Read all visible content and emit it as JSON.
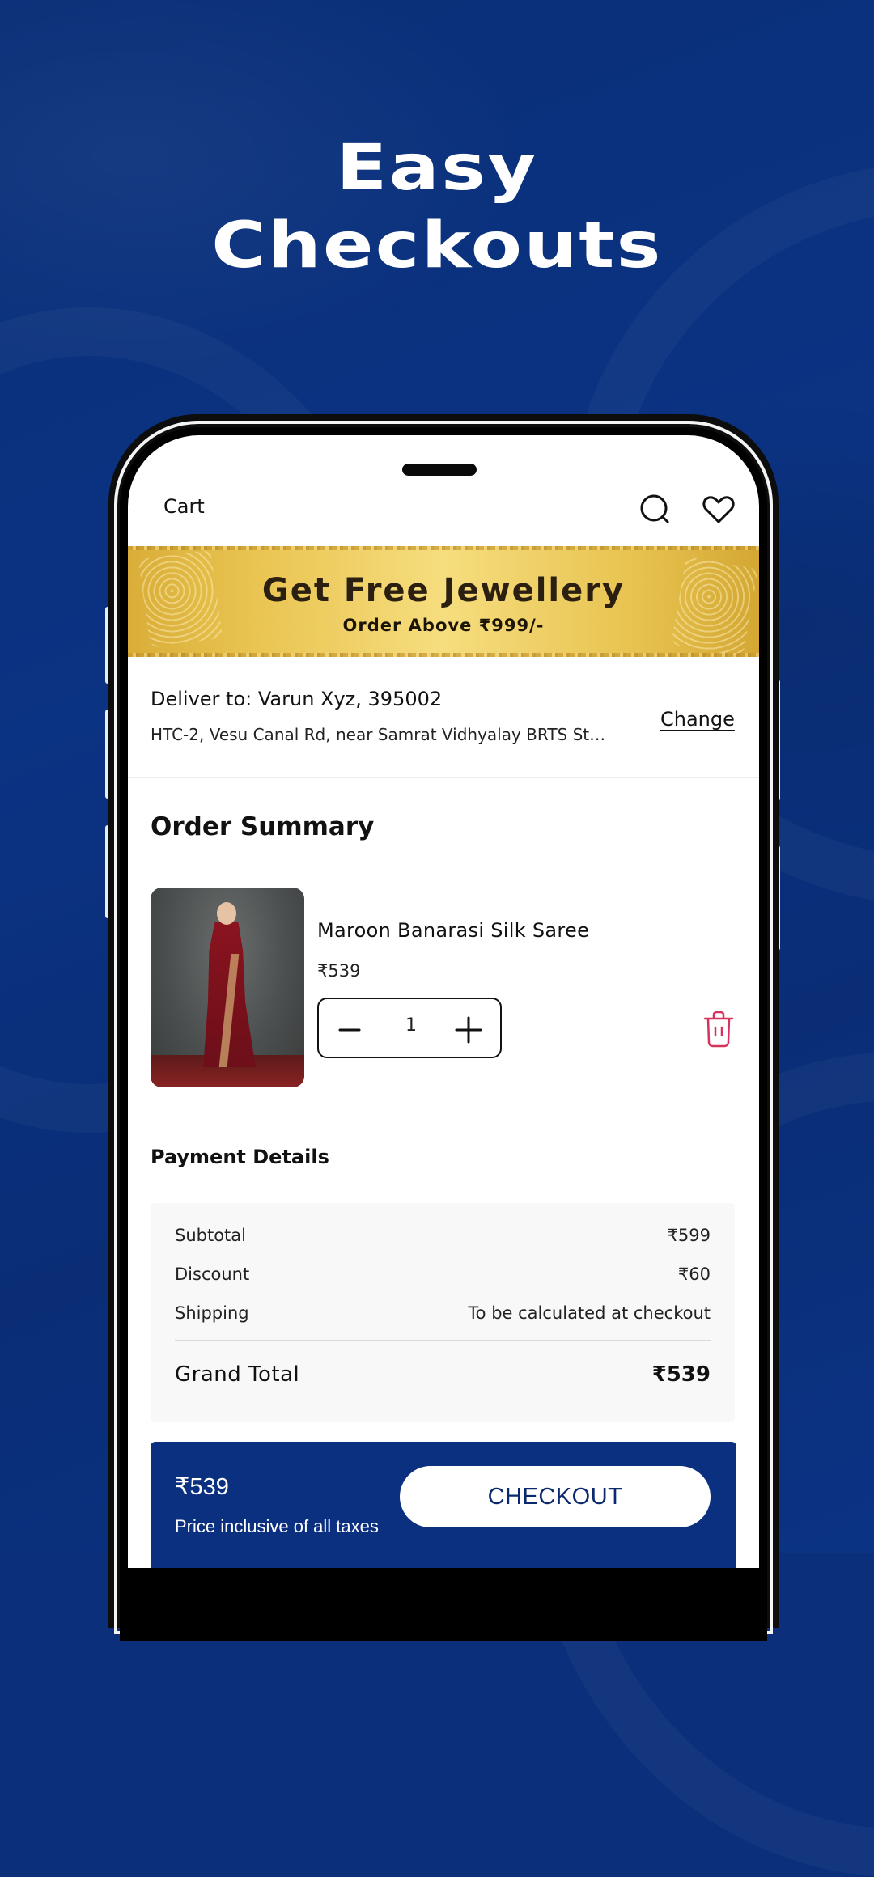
{
  "promo": {
    "headline_line1": "Easy",
    "headline_line2": "Checkouts"
  },
  "colors": {
    "background": "#0b2f7a",
    "footer_bar": "#0b3080",
    "banner_gold": "#e9c451",
    "delete_icon": "#d6335c"
  },
  "header": {
    "title": "Cart",
    "icons": [
      "search-icon",
      "heart-icon"
    ]
  },
  "banner": {
    "title": "Get Free Jewellery",
    "subtitle": "Order Above ₹999/-"
  },
  "delivery": {
    "line1": "Deliver to: Varun Xyz, 395002",
    "line2": "HTC-2, Vesu Canal Rd, near Samrat Vidhyalay BRTS St…",
    "change_label": "Change"
  },
  "order_summary": {
    "title": "Order Summary",
    "items": [
      {
        "name": "Maroon Banarasi Silk Saree",
        "price": "₹539",
        "quantity": "1",
        "image_alt": "Woman wearing maroon Banarasi silk saree"
      }
    ]
  },
  "payment": {
    "title": "Payment Details",
    "rows": [
      {
        "label": "Subtotal",
        "value": "₹599"
      },
      {
        "label": "Discount",
        "value": "₹60"
      },
      {
        "label": "Shipping",
        "value": "To be calculated at checkout"
      }
    ],
    "grand_total_label": "Grand Total",
    "grand_total_value": "₹539"
  },
  "footer": {
    "price": "₹539",
    "note": "Price inclusive of all taxes",
    "checkout_label": "CHECKOUT"
  }
}
